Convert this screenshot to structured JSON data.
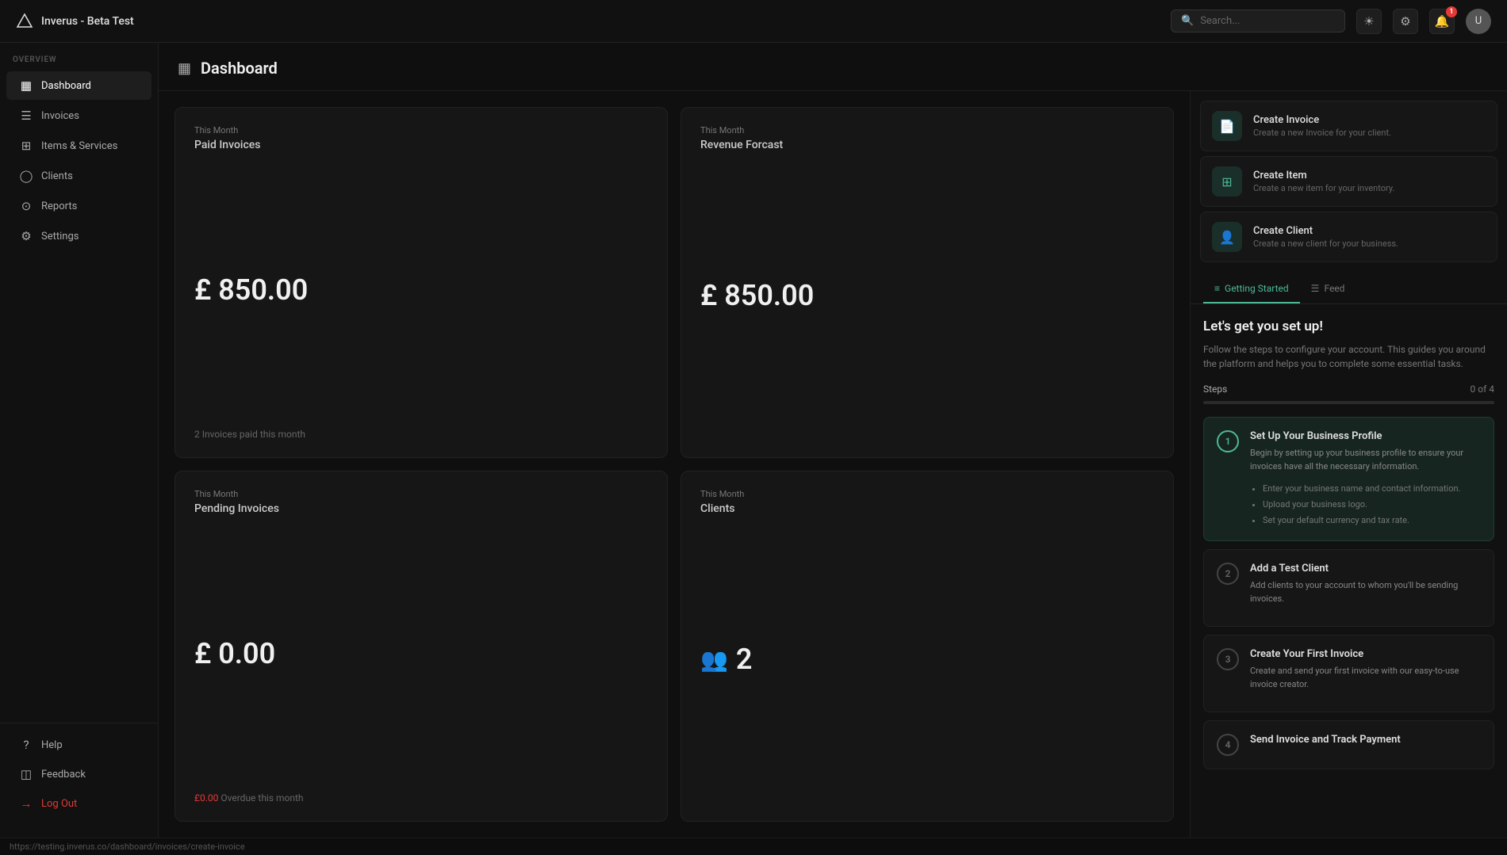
{
  "app": {
    "title": "Inverus - Beta Test",
    "logo_char": "▲"
  },
  "topbar": {
    "search_placeholder": "Search...",
    "search_label": "Search _",
    "notif_count": "1"
  },
  "sidebar": {
    "overview_label": "Overview",
    "items": [
      {
        "id": "dashboard",
        "label": "Dashboard",
        "icon": "▦",
        "active": true
      },
      {
        "id": "invoices",
        "label": "Invoices",
        "icon": "☰"
      },
      {
        "id": "items-services",
        "label": "Items & Services",
        "icon": "⊞"
      },
      {
        "id": "clients",
        "label": "Clients",
        "icon": "◯"
      },
      {
        "id": "reports",
        "label": "Reports",
        "icon": "⊙"
      },
      {
        "id": "settings",
        "label": "Settings",
        "icon": "⚙"
      }
    ],
    "bottom_items": [
      {
        "id": "help",
        "label": "Help",
        "icon": "?"
      },
      {
        "id": "feedback",
        "label": "Feedback",
        "icon": "◫"
      },
      {
        "id": "logout",
        "label": "Log Out",
        "icon": "→"
      }
    ]
  },
  "page": {
    "title": "Dashboard",
    "icon": "▦"
  },
  "stats": [
    {
      "id": "paid-invoices",
      "period": "This Month",
      "title": "Paid Invoices",
      "value": "£ 850.00",
      "footer": "2 Invoices paid this month",
      "footer_type": "normal"
    },
    {
      "id": "revenue-forecast",
      "period": "This Month",
      "title": "Revenue Forcast",
      "value": "£ 850.00",
      "footer": "",
      "footer_type": "normal"
    },
    {
      "id": "pending-invoices",
      "period": "This Month",
      "title": "Pending Invoices",
      "value": "£ 0.00",
      "footer_overdue": "£0.00",
      "footer_suffix": " Overdue this month",
      "footer_type": "overdue"
    },
    {
      "id": "clients",
      "period": "This Month",
      "title": "Clients",
      "value": "2",
      "footer": "",
      "footer_type": "normal"
    }
  ],
  "quick_actions": [
    {
      "id": "create-invoice",
      "title": "Create Invoice",
      "subtitle": "Create a new Invoice for your client.",
      "icon": "📄"
    },
    {
      "id": "create-item",
      "title": "Create Item",
      "subtitle": "Create a new item for your inventory.",
      "icon": "⊞"
    },
    {
      "id": "create-client",
      "title": "Create Client",
      "subtitle": "Create a new client for your business.",
      "icon": "👤"
    }
  ],
  "getting_started": {
    "tabs": [
      {
        "id": "getting-started",
        "label": "Getting Started",
        "icon": "≡",
        "active": true
      },
      {
        "id": "feed",
        "label": "Feed",
        "icon": "☰",
        "active": false
      }
    ],
    "title": "Let's get you set up!",
    "subtitle": "Follow the steps to configure your account. This guides you around the platform and helps you to complete some essential tasks.",
    "steps_label": "Steps",
    "steps_progress": "0 of 4",
    "progress_percent": 0,
    "steps": [
      {
        "number": "1",
        "title": "Set Up Your Business Profile",
        "subtitle": "Begin by setting up your business profile to ensure your invoices have all the necessary information.",
        "bullets": [
          "Enter your business name and contact information.",
          "Upload your business logo.",
          "Set your default currency and tax rate."
        ],
        "active": true
      },
      {
        "number": "2",
        "title": "Add a Test Client",
        "subtitle": "Add clients to your account to whom you'll be sending invoices.",
        "bullets": [],
        "active": false
      },
      {
        "number": "3",
        "title": "Create Your First Invoice",
        "subtitle": "Create and send your first invoice with our easy-to-use invoice creator.",
        "bullets": [],
        "active": false
      },
      {
        "number": "4",
        "title": "Send Invoice and Track Payment",
        "subtitle": "",
        "bullets": [],
        "active": false
      }
    ]
  },
  "url_bar": "https://testing.inverus.co/dashboard/invoices/create-invoice"
}
